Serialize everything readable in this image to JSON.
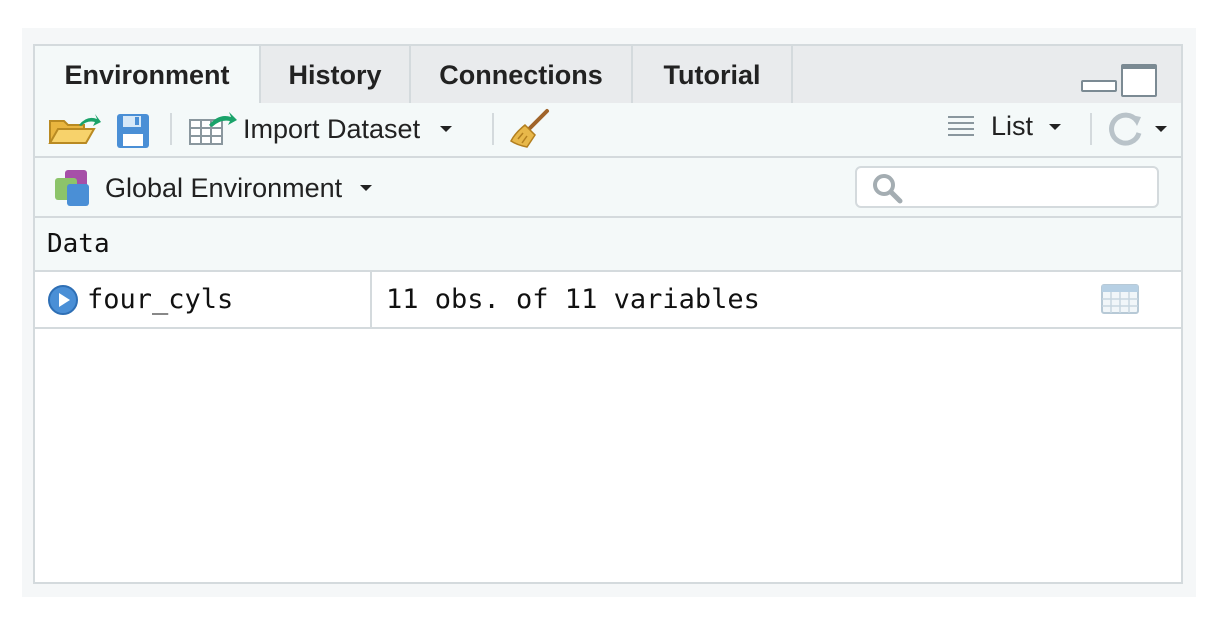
{
  "tabs": [
    {
      "label": "Environment",
      "active": true
    },
    {
      "label": "History",
      "active": false
    },
    {
      "label": "Connections",
      "active": false
    },
    {
      "label": "Tutorial",
      "active": false
    }
  ],
  "toolbar": {
    "open_icon": "folder-open-icon",
    "save_icon": "save-icon",
    "import_label": "Import Dataset",
    "clear_icon": "broom-icon",
    "view_label": "List",
    "refresh_icon": "refresh-icon"
  },
  "environment": {
    "selector_label": "Global Environment",
    "search_value": "",
    "search_icon": "search-icon"
  },
  "data_section": {
    "header": "Data",
    "rows": [
      {
        "name": "four_cyls",
        "value": "11 obs. of 11 variables"
      }
    ]
  },
  "colors": {
    "tab_bar_bg": "#e9ebed",
    "toolbar_bg": "#f4f9f9",
    "border": "#d4dadd",
    "accent_blue": "#4a8fd6",
    "accent_green": "#1aa36a"
  }
}
